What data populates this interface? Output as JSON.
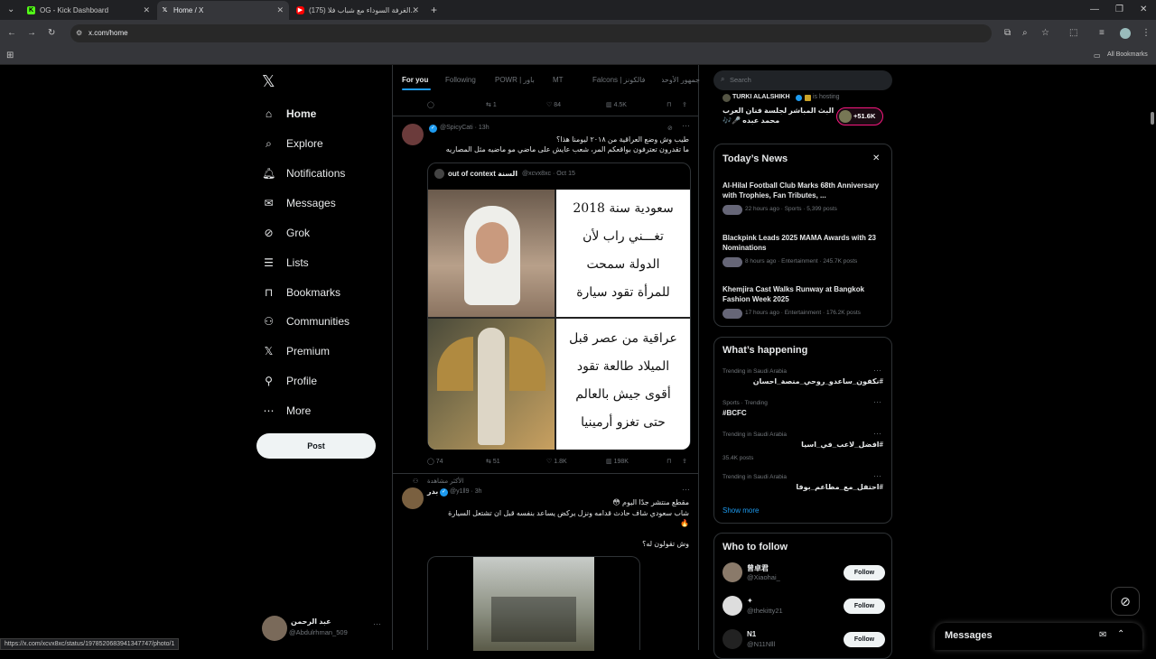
{
  "browser": {
    "tabs": [
      {
        "label": "OG - Kick Dashboard",
        "icon": "kick-icon"
      },
      {
        "label": "Home / X",
        "icon": "x-icon"
      },
      {
        "label": "(175) الغرفة السوداء مع شباب فلا...",
        "icon": "youtube-icon"
      }
    ],
    "url": "x.com/home",
    "bookmarks_label": "All Bookmarks",
    "status_url": "https://x.com/xcvx8xc/status/1978520683941347747/photo/1"
  },
  "nav": {
    "items": [
      {
        "label": "Home",
        "icon": "home-icon"
      },
      {
        "label": "Explore",
        "icon": "search-icon"
      },
      {
        "label": "Notifications",
        "icon": "bell-icon"
      },
      {
        "label": "Messages",
        "icon": "mail-icon"
      },
      {
        "label": "Grok",
        "icon": "grok-icon"
      },
      {
        "label": "Lists",
        "icon": "list-icon"
      },
      {
        "label": "Bookmarks",
        "icon": "bookmark-icon"
      },
      {
        "label": "Communities",
        "icon": "people-icon"
      },
      {
        "label": "Premium",
        "icon": "x-icon"
      },
      {
        "label": "Profile",
        "icon": "person-icon"
      },
      {
        "label": "More",
        "icon": "more-circle-icon"
      }
    ],
    "post_label": "Post",
    "account_name": "عبد الرحمن",
    "account_handle": "@Abdulrhman_509"
  },
  "timeline": {
    "tabs": [
      "For you",
      "Following",
      "POWR | باور",
      "MT",
      "Falcons | فالكونز",
      "جمهور الأوحد"
    ],
    "top_actions": {
      "retweets": "1",
      "likes": "84",
      "views": "4.5K"
    },
    "tweet1": {
      "handle": "@SpicyCati",
      "time": "13h",
      "line1": "طيب وش وضع العراقية من ٢٠١٨ ليومنا هذا؟",
      "line2": "ما تقدرون تعترفون بواقعكم المر، شعب عايش على ماضي مو ماضيه مثل المصاريه",
      "quote_name": "out of context السنة",
      "quote_handle": "@xcvx8xc",
      "quote_time": "Oct 15",
      "img_text_top": [
        "سعودية سنة 2018",
        "تغـــني راب لأن",
        "الدولة سمحت",
        "للمرأة تقود سيارة"
      ],
      "img_text_bottom": [
        "عراقية من عصر قبل",
        "الميلاد طالعة تقود",
        "أقوى جيش بالعالم",
        "حتى تغزو أرمينيا"
      ],
      "replies": "74",
      "retweets": "51",
      "likes": "1.8K",
      "views": "198K"
    },
    "tweet2": {
      "context": "الأكثر مشاهدة",
      "name": "بدر",
      "handle": "@y1ll9",
      "time": "3h",
      "line1": "مقطع منتشر جدًا اليوم 😳",
      "line2": "شاب سعودي شاف حادث قدامه ونزل يركض يساعد بنفسه قبل ان تشتعل السيارة",
      "line3": "وش تقولون له؟"
    }
  },
  "right": {
    "search_placeholder": "Search",
    "live": {
      "host": "TURKI ALALSHIKH",
      "status": "is hosting",
      "title": "البث المباشر لجلسة فنان العرب",
      "subtitle": "محمد عبده 🎤🎶",
      "count": "+51.6K"
    },
    "news": {
      "title": "Today’s News",
      "items": [
        {
          "title": "Al-Hilal Football Club Marks 68th Anniversary with Trophies, Fan Tributes, ...",
          "meta": "22 hours ago · Sports · 5,399 posts"
        },
        {
          "title": "Blackpink Leads 2025 MAMA Awards with 23 Nominations",
          "meta": "8 hours ago · Entertainment · 245.7K posts"
        },
        {
          "title": "Khemjira Cast Walks Runway at Bangkok Fashion Week 2025",
          "meta": "17 hours ago · Entertainment · 176.2K posts"
        }
      ]
    },
    "happening": {
      "title": "What’s happening",
      "items": [
        {
          "category": "Trending in Saudi Arabia",
          "name": "#نكفون_ساعدو_روحي_منصة_احسان",
          "posts": ""
        },
        {
          "category": "Sports · Trending",
          "name": "#BCFC",
          "posts": ""
        },
        {
          "category": "Trending in Saudi Arabia",
          "name": "#افضل_لاعب_في_اسيا",
          "posts": "35.4K posts"
        },
        {
          "category": "Trending in Saudi Arabia",
          "name": "#احتفل_مع_مطاعم_بوفا",
          "posts": ""
        }
      ],
      "show_more": "Show more"
    },
    "follow": {
      "title": "Who to follow",
      "button": "Follow",
      "items": [
        {
          "name": "曾卓君",
          "handle": "@Xiaohai_"
        },
        {
          "name": "✦",
          "handle": "@thekitty21"
        },
        {
          "name": "N1",
          "handle": "@N11Nlll"
        }
      ]
    },
    "messages_label": "Messages"
  },
  "colors": {
    "accent": "#1d9bf0",
    "background": "#000000",
    "border": "#2f3336",
    "muted": "#71767b",
    "live": "#f91880"
  }
}
